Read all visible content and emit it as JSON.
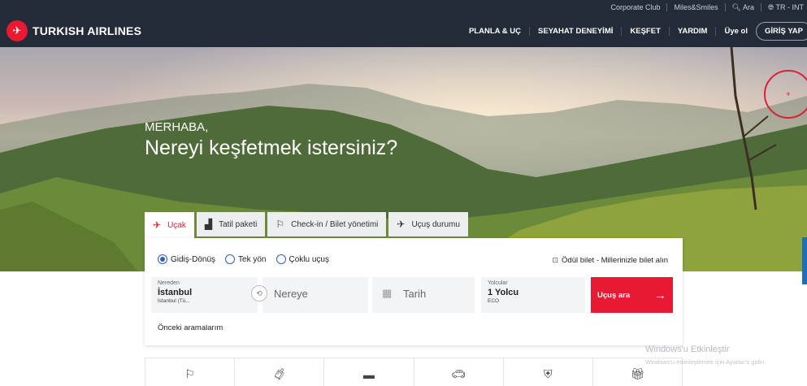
{
  "utility_bar": {
    "corporate": "Corporate Club",
    "miles": "Miles&Smiles",
    "search": "Ara",
    "region": "TR - INT"
  },
  "header": {
    "brand": "TURKISH AIRLINES",
    "nav": [
      "PLANLA & UÇ",
      "SEYAHAT DENEYİMİ",
      "KEŞFET",
      "YARDIM"
    ],
    "signup": "Üye ol",
    "login": "GİRİŞ YAP"
  },
  "hero": {
    "greeting": "MERHABA,",
    "title": "Nereyi keşfetmek istersiniz?"
  },
  "tabs": [
    {
      "label": "Uçak",
      "icon": "plane-icon"
    },
    {
      "label": "Tatil paketi",
      "icon": "building-icon"
    },
    {
      "label": "Check-in / Bilet yönetimi",
      "icon": "checkin-icon"
    },
    {
      "label": "Uçuş durumu",
      "icon": "flight-status-icon"
    }
  ],
  "booking": {
    "trip_types": [
      "Gidiş-Dönüş",
      "Tek yön",
      "Çoklu uçuş"
    ],
    "award": "Ödül bilet - Millerinizle bilet alın",
    "from": {
      "label": "Nereden",
      "city": "İstanbul",
      "sub": "İstanbul (Tü..."
    },
    "to_placeholder": "Nereye",
    "date_placeholder": "Tarih",
    "pax": {
      "label": "Yolcular",
      "value": "1 Yolcu",
      "cabin": "ECO"
    },
    "search_button": "Uçuş ara",
    "recent": "Önceki aramalarım"
  },
  "quick_icons": [
    "checkin-icon",
    "baggage-icon",
    "bed-icon",
    "car-icon",
    "shield-icon",
    "gift-icon"
  ],
  "watermark": {
    "title": "Windows'u Etkinleştir",
    "sub": "Windows'u etkinleştirmek için Ayarlar'a gidin."
  },
  "colors": {
    "brand_red": "#e81932",
    "header_bg": "#232b38",
    "radio_blue": "#2f5fb3"
  }
}
